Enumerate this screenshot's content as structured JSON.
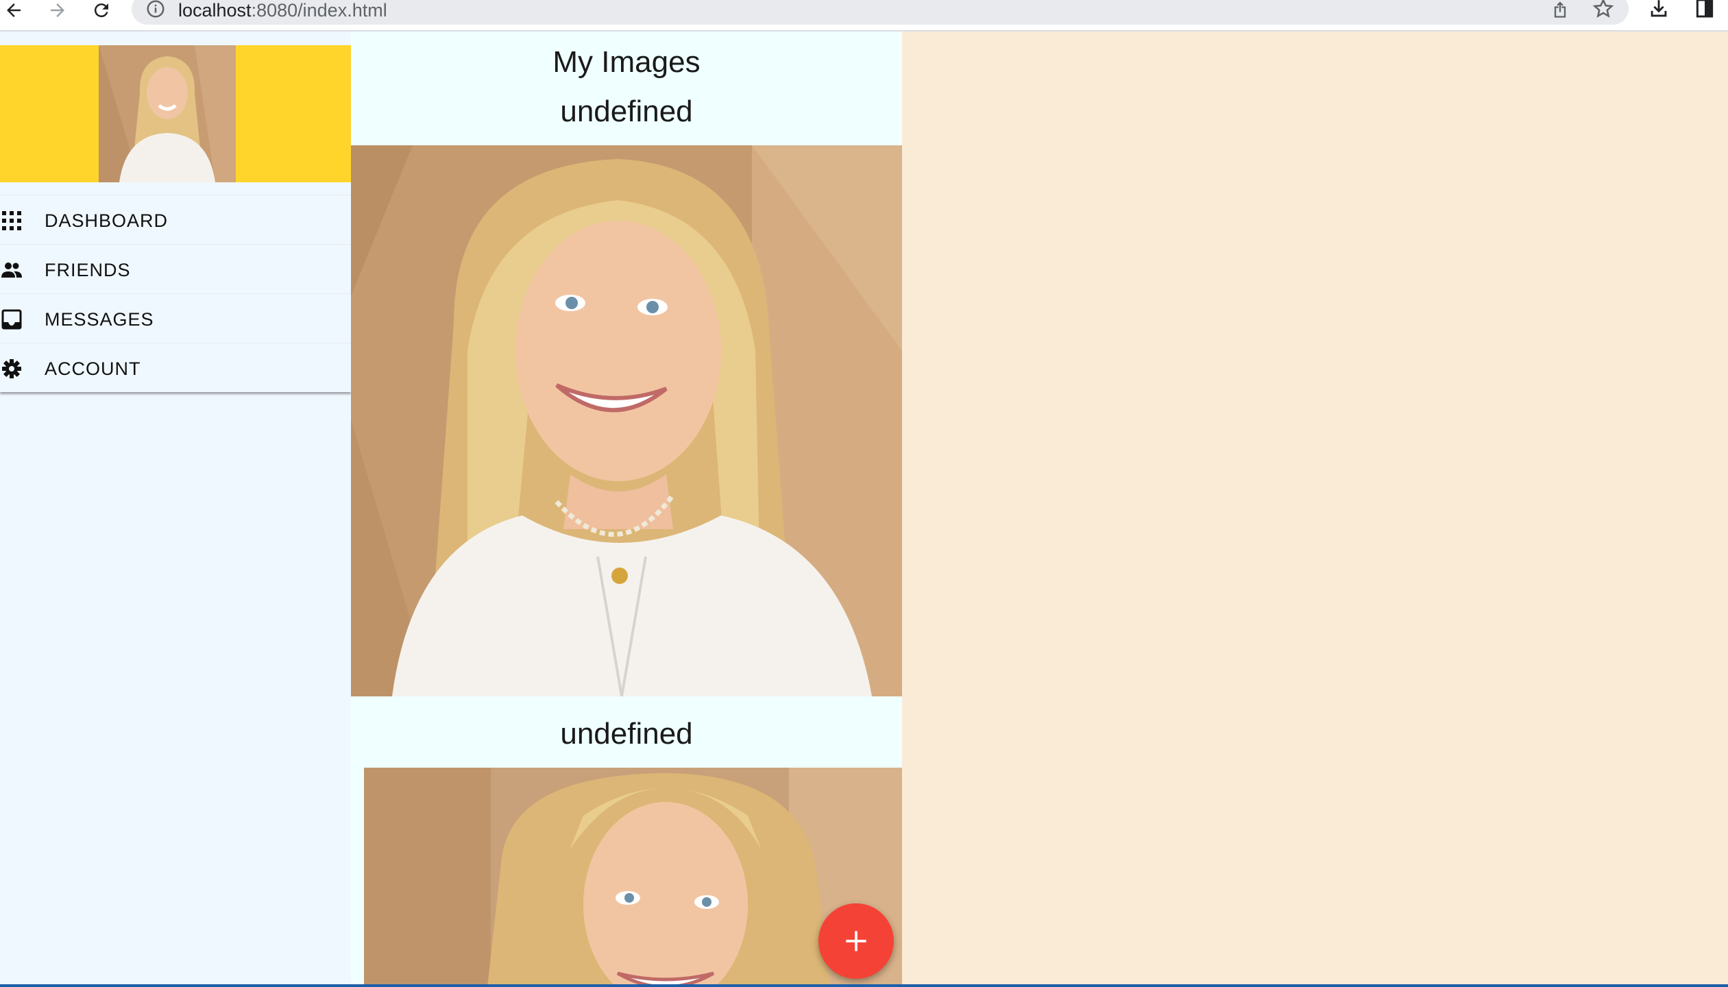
{
  "browser": {
    "url_host": "localhost",
    "url_rest": ":8080/index.html"
  },
  "drawer": {
    "header_color": "#ffd52b",
    "items": [
      {
        "label": "DASHBOARD",
        "icon": "apps-grid-icon"
      },
      {
        "label": "FRIENDS",
        "icon": "people-icon"
      },
      {
        "label": "MESSAGES",
        "icon": "inbox-icon"
      },
      {
        "label": "ACCOUNT",
        "icon": "gear-icon"
      }
    ]
  },
  "main": {
    "title": "My Images",
    "images": [
      {
        "caption": "undefined"
      },
      {
        "caption": "undefined"
      }
    ]
  },
  "fab": {
    "icon": "plus-icon",
    "color": "#f44336"
  },
  "colors": {
    "page_bg": "#faebd7",
    "drawer_bg": "#f0f8ff",
    "content_bg": "#f0ffff"
  }
}
